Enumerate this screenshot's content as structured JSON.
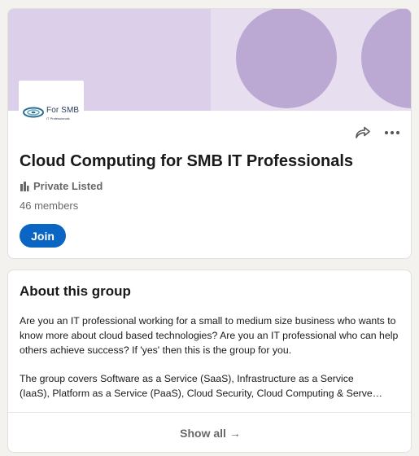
{
  "group": {
    "logo_text": "For SMB",
    "logo_subtext": "IT Professionals",
    "title": "Cloud Computing for SMB IT Professionals",
    "privacy": "Private Listed",
    "members": "46 members",
    "join_label": "Join"
  },
  "about": {
    "heading": "About this group",
    "paragraph1": "Are you an IT professional working for a small to medium size business who wants to know more about cloud based technologies? Are you an IT professional who can help others achieve success? If 'yes' then this is the group for you.",
    "paragraph2_line1": "The group covers Software as a Service (SaaS), Infrastructure as a Service",
    "paragraph2_line2": "(IaaS), Platform as a Service (PaaS), Cloud Security, Cloud Computing & Serve…",
    "show_all_label": "Show all →"
  },
  "icons": {
    "share": "share-arrow-icon",
    "more": "more-dots-icon",
    "privacy": "building-icon"
  },
  "colors": {
    "accent": "#0a66c2",
    "banner_bg": "#dccfe9",
    "banner_circle": "#bba8d3"
  }
}
